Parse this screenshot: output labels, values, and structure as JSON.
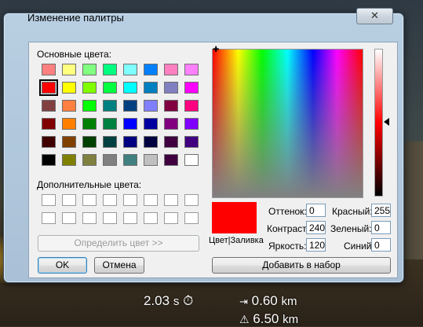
{
  "dialog": {
    "title": "Изменение палитры",
    "close_glyph": "✕"
  },
  "labels": {
    "basic_colors": "Основные цвета:",
    "custom_colors": "Дополнительные цвета:",
    "color_solid": "Цвет|Заливка",
    "hue": "Оттенок:",
    "sat": "Контраст:",
    "lum": "Яркость:",
    "red": "Красный:",
    "green": "Зеленый:",
    "blue": "Синий:"
  },
  "values": {
    "hue": "0",
    "sat": "240",
    "lum": "120",
    "red": "255",
    "green": "0",
    "blue": "0"
  },
  "buttons": {
    "define": "Определить цвет >>",
    "ok": "OK",
    "cancel": "Отмена",
    "add": "Добавить в набор"
  },
  "basic_colors": [
    [
      "#ff8080",
      "#ffff80",
      "#80ff80",
      "#00ff80",
      "#80ffff",
      "#0080ff",
      "#ff80c0",
      "#ff80ff"
    ],
    [
      "#ff0000",
      "#ffff00",
      "#80ff00",
      "#00ff40",
      "#00ffff",
      "#0080c0",
      "#8080c0",
      "#ff00ff"
    ],
    [
      "#804040",
      "#ff8040",
      "#00ff00",
      "#008080",
      "#004080",
      "#8080ff",
      "#800040",
      "#ff0080"
    ],
    [
      "#800000",
      "#ff8000",
      "#008000",
      "#008040",
      "#0000ff",
      "#0000a0",
      "#800080",
      "#8000ff"
    ],
    [
      "#400000",
      "#804000",
      "#004000",
      "#004040",
      "#000080",
      "#000040",
      "#400040",
      "#400080"
    ],
    [
      "#000000",
      "#808000",
      "#808040",
      "#808080",
      "#408080",
      "#c0c0c0",
      "#400040",
      "#ffffff"
    ]
  ],
  "selected_color": "#ff0000",
  "hud": {
    "time": "2.03",
    "time_unit": "s",
    "distance": "0.60",
    "distance_unit": "km",
    "distance2": "6.50",
    "distance2_unit": "km"
  }
}
